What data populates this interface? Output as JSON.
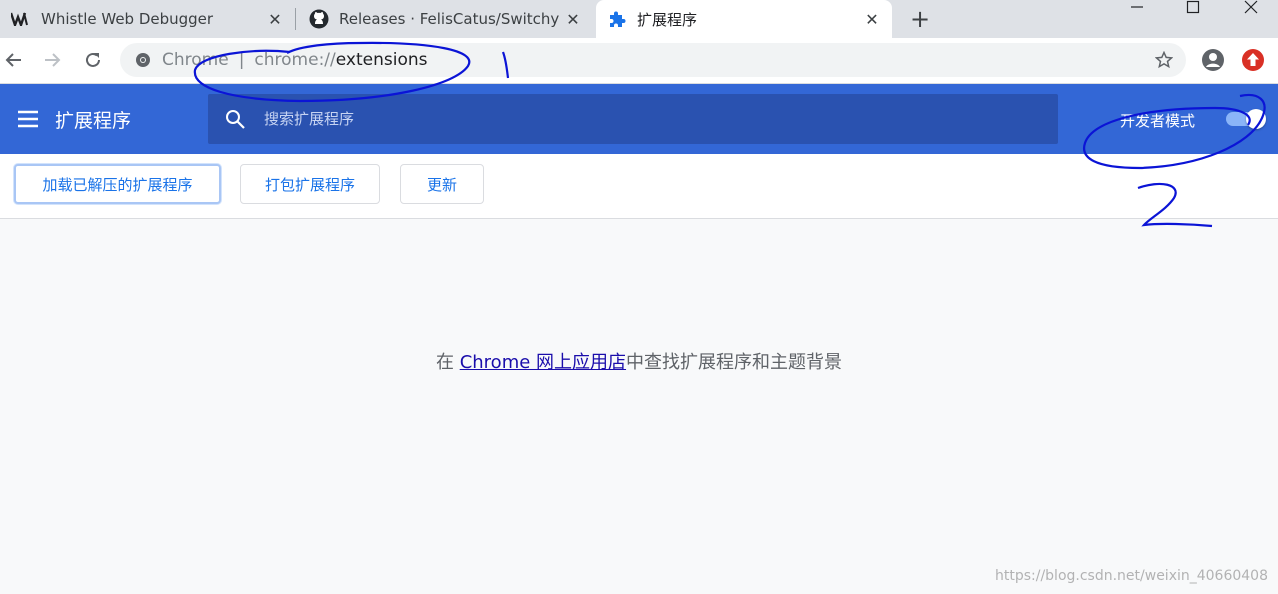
{
  "tabs": [
    {
      "title": "Whistle Web Debugger",
      "icon": "whistle-icon"
    },
    {
      "title": "Releases · FelisCatus/SwitchyO",
      "icon": "github-icon"
    },
    {
      "title": "扩展程序",
      "icon": "puzzle-icon",
      "active": true
    }
  ],
  "omnibox": {
    "scheme_label": "Chrome",
    "separator": "|",
    "url_prefix": "chrome://",
    "url_path": "extensions"
  },
  "header": {
    "title": "扩展程序",
    "search_placeholder": "搜索扩展程序",
    "devmode_label": "开发者模式",
    "devmode_on": true
  },
  "actions": {
    "load_unpacked": "加载已解压的扩展程序",
    "pack": "打包扩展程序",
    "update": "更新"
  },
  "message": {
    "prefix": "在 ",
    "link": "Chrome 网上应用店",
    "suffix": "中查找扩展程序和主题背景"
  },
  "annotations": {
    "note_1": "1",
    "note_2": "2"
  },
  "watermark": "https://blog.csdn.net/weixin_40660408",
  "colors": {
    "header_blue": "#3367d6",
    "search_blue": "#2a52b0",
    "link_blue": "#1a73e8",
    "annotation_ink": "#0b14d6"
  }
}
